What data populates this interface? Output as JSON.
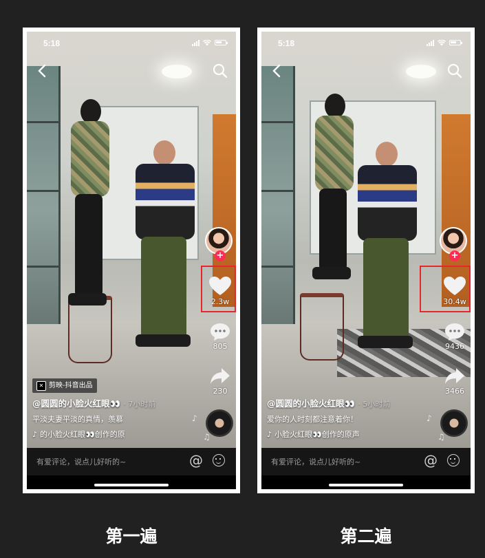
{
  "panels": [
    {
      "label": "第一遍",
      "status_time": "5:18",
      "like_count": "2.3w",
      "comment_count": "805",
      "share_count": "230",
      "capcut_tag": "剪映-抖音出品",
      "author": "@圆圆的小脸火红眼👀",
      "time_ago": "· 7小时前",
      "description": "平淡夫妻平淡的真情，羡慕",
      "music": "的小脸火红眼👀创作的原",
      "comment_placeholder": "有爱评论，说点儿好听的~",
      "at_symbol": "@"
    },
    {
      "label": "第二遍",
      "status_time": "5:18",
      "like_count": "30.4w",
      "comment_count": "9436",
      "share_count": "3466",
      "author": "@圆圆的小脸火红眼👀",
      "time_ago": "· 5小时前",
      "description": "爱你的人时刻都注意着你！",
      "music": "小脸火红眼👀创作的原声",
      "comment_placeholder": "有爱评论，说点儿好听的~",
      "at_symbol": "@"
    }
  ],
  "highlight_color": "#e6262b",
  "accent_color": "#fe2c55"
}
